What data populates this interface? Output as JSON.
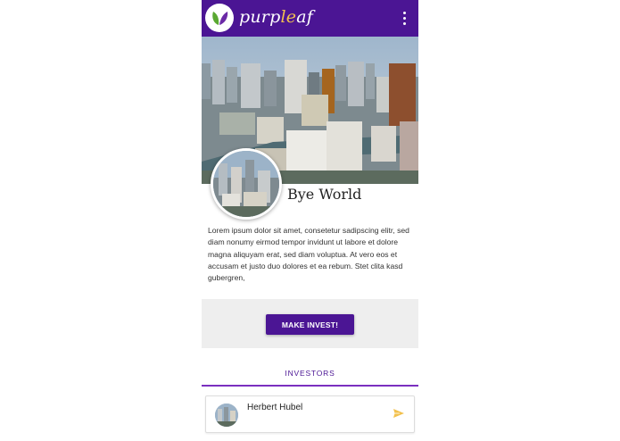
{
  "app_bar": {
    "brand_prefix": "purp",
    "brand_accent": "le",
    "brand_suffix": "af",
    "logo_icon": "leaf-logo-icon",
    "menu_icon": "more-vert-icon",
    "color": "#4b1594"
  },
  "project": {
    "title": "Bye World",
    "hero_image": "city-skyline-photo",
    "description": "Lorem ipsum dolor sit amet, consetetur sadipscing elitr, sed diam nonumy eirmod tempor invidunt ut labore et dolore magna aliquyam erat, sed diam voluptua. At vero eos et accusam et justo duo dolores et ea rebum. Stet clita kasd gubergren,"
  },
  "cta": {
    "label": "MAKE INVEST!"
  },
  "tabs": {
    "investors_label": "INVESTORS"
  },
  "investors": [
    {
      "name": "Herbert Hubel",
      "action_icon": "send-icon"
    }
  ],
  "colors": {
    "primary": "#4b1594",
    "accent": "#f2c14e",
    "tab_indicator": "#7b2fbf",
    "cta_background": "#eeeeee"
  }
}
